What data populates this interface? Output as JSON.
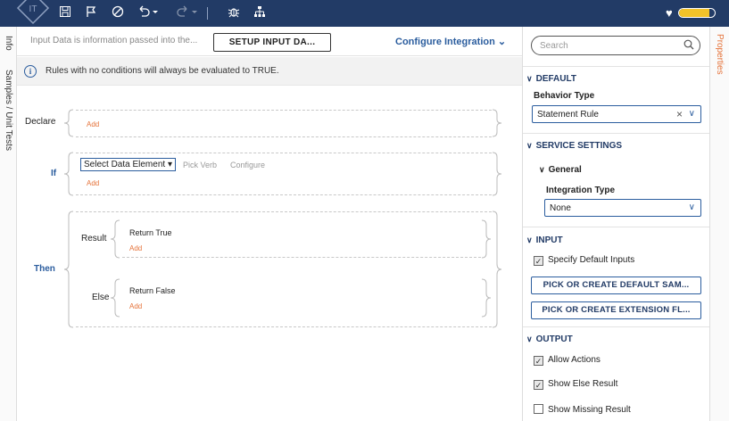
{
  "toolbar": {
    "icons": [
      "logo-icon",
      "save-icon",
      "flag-icon",
      "disable-icon",
      "undo-icon",
      "redo-icon",
      "debug-icon",
      "tree-icon"
    ],
    "progress": 0.85,
    "accent": "#f2c32a",
    "bar_color": "#223b66"
  },
  "left_tabs": {
    "info": "Info",
    "samples": "Samples / Unit Tests"
  },
  "config_bar": {
    "description": "Input Data is information passed into the...",
    "setup_button": "SETUP INPUT DA...",
    "configure": "Configure Integration"
  },
  "info_bar": {
    "text": "Rules with no conditions will always be evaluated to TRUE."
  },
  "rule": {
    "declare_label": "Declare",
    "declare_add": "Add",
    "if_label": "If",
    "select_data": "Select Data Element",
    "pick_verb": "Pick Verb",
    "configure": "Configure",
    "if_add": "Add",
    "then_label": "Then",
    "result_label": "Result",
    "result_stmt": "Return True",
    "result_add": "Add",
    "else_label": "Else",
    "else_stmt": "Return False",
    "else_add": "Add"
  },
  "panel": {
    "search_placeholder": "Search",
    "tab": "Properties",
    "default_head": "DEFAULT",
    "behavior_label": "Behavior Type",
    "behavior_value": "Statement Rule",
    "service_head": "SERVICE SETTINGS",
    "general_head": "General",
    "integration_label": "Integration Type",
    "integration_value": "None",
    "input_head": "INPUT",
    "specify_default": "Specify Default Inputs",
    "specify_default_checked": true,
    "pick_default": "PICK OR CREATE DEFAULT SAM...",
    "pick_extension": "PICK OR CREATE EXTENSION FL...",
    "output_head": "OUTPUT",
    "allow_actions": "Allow Actions",
    "allow_actions_checked": true,
    "show_else": "Show Else Result",
    "show_else_checked": true,
    "show_missing": "Show Missing Result",
    "show_missing_checked": false
  }
}
